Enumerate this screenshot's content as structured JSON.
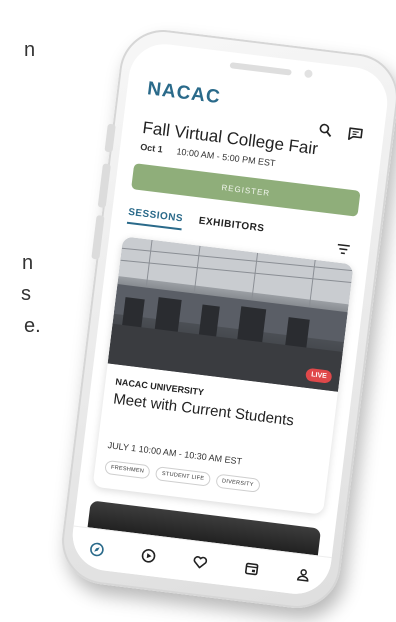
{
  "side_text": {
    "n1": "n",
    "n2": "n",
    "s": "s",
    "e": "e."
  },
  "app": {
    "logo": "NACAC",
    "event_title": "Fall Virtual College Fair",
    "event_date": "Oct 1",
    "event_time": "10:00 AM - 5:00 PM EST",
    "register_label": "REGISTER"
  },
  "tabs": [
    {
      "label": "SESSIONS",
      "active": true
    },
    {
      "label": "EXHIBITORS",
      "active": false
    }
  ],
  "session_card": {
    "live_badge": "LIVE",
    "organizer": "NACAC UNIVERSITY",
    "title": "Meet with Current Students",
    "time": "JULY 1 10:00 AM - 10:30 AM EST",
    "tags": [
      "FRESHMEN",
      "STUDENT LIFE",
      "DIVERSITY"
    ]
  },
  "icons": {
    "top": [
      "search-icon",
      "chat-icon"
    ],
    "filter": "filter-icon",
    "nav": [
      "explore-icon",
      "play-icon",
      "heart-icon",
      "calendar-icon",
      "profile-icon"
    ],
    "accent": "#2a6a8a",
    "register_color": "#8fae7a",
    "live_color": "#e0484a"
  }
}
